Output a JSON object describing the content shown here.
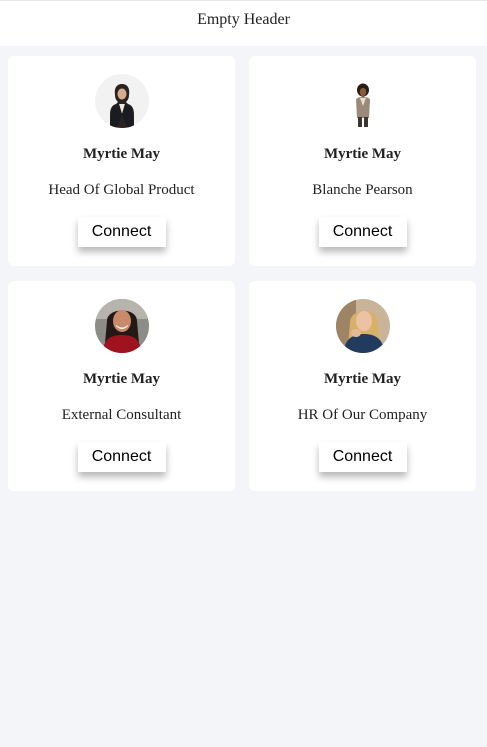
{
  "header": {
    "title": "Empty Header"
  },
  "cards": [
    {
      "name": "Myrtie May",
      "role": "Head Of Global Product",
      "button": "Connect",
      "avatar_icon": "person-avatar-icon"
    },
    {
      "name": "Myrtie May",
      "role": "Blanche Pearson",
      "button": "Connect",
      "avatar_icon": "person-avatar-icon"
    },
    {
      "name": "Myrtie May",
      "role": "External Consultant",
      "button": "Connect",
      "avatar_icon": "person-avatar-icon"
    },
    {
      "name": "Myrtie May",
      "role": "HR Of Our Company",
      "button": "Connect",
      "avatar_icon": "person-avatar-icon"
    }
  ],
  "colors": {
    "background": "#f4f5f9",
    "card": "#ffffff",
    "text": "#222222"
  }
}
